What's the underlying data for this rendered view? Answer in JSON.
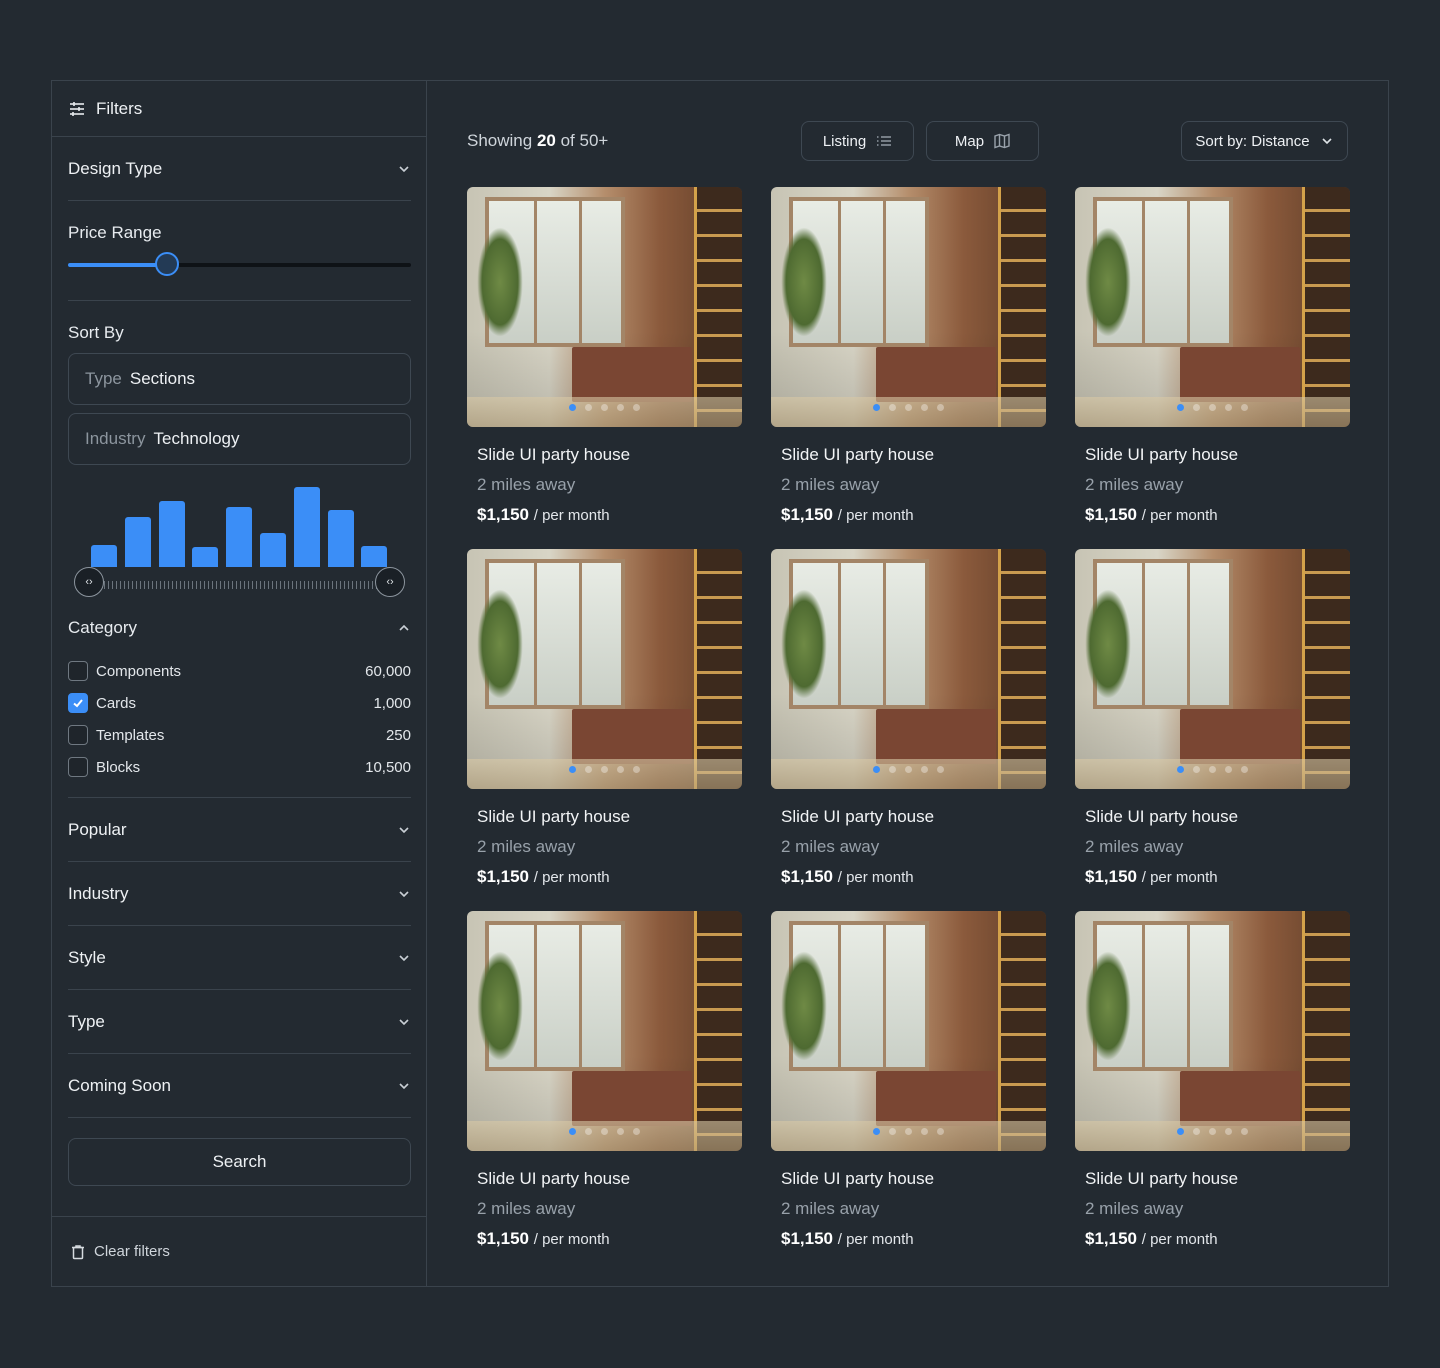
{
  "sidebar": {
    "title": "Filters",
    "design_type": "Design Type",
    "price_range": {
      "label": "Price Range",
      "value_fraction": 0.29
    },
    "sort_by": {
      "label": "Sort By",
      "fields": [
        {
          "key": "Type",
          "value": "Sections"
        },
        {
          "key": "Industry",
          "value": "Technology"
        }
      ]
    },
    "histogram": [
      0.28,
      0.62,
      0.82,
      0.25,
      0.75,
      0.43,
      1.0,
      0.71,
      0.26
    ],
    "category": {
      "label": "Category",
      "items": [
        {
          "label": "Components",
          "count": "60,000",
          "checked": false
        },
        {
          "label": "Cards",
          "count": "1,000",
          "checked": true
        },
        {
          "label": "Templates",
          "count": "250",
          "checked": false
        },
        {
          "label": "Blocks",
          "count": "10,500",
          "checked": false
        }
      ]
    },
    "sections": [
      "Popular",
      "Industry",
      "Style",
      "Type",
      "Coming Soon"
    ],
    "search_label": "Search",
    "clear_label": "Clear filters"
  },
  "toolbar": {
    "showing_prefix": "Showing ",
    "showing_count": "20",
    "showing_suffix": " of 50+",
    "listing_label": "Listing",
    "map_label": "Map",
    "sort_label": "Sort by: Distance"
  },
  "cards": [
    {
      "title": "Slide UI party house",
      "distance": "2 miles away",
      "price": "$1,150",
      "unit": "/ per month"
    },
    {
      "title": "Slide UI party house",
      "distance": "2 miles away",
      "price": "$1,150",
      "unit": "/ per month"
    },
    {
      "title": "Slide UI party house",
      "distance": "2 miles away",
      "price": "$1,150",
      "unit": "/ per month"
    },
    {
      "title": "Slide UI party house",
      "distance": "2 miles away",
      "price": "$1,150",
      "unit": "/ per month"
    },
    {
      "title": "Slide UI party house",
      "distance": "2 miles away",
      "price": "$1,150",
      "unit": "/ per month"
    },
    {
      "title": "Slide UI party house",
      "distance": "2 miles away",
      "price": "$1,150",
      "unit": "/ per month"
    },
    {
      "title": "Slide UI party house",
      "distance": "2 miles away",
      "price": "$1,150",
      "unit": "/ per month"
    },
    {
      "title": "Slide UI party house",
      "distance": "2 miles away",
      "price": "$1,150",
      "unit": "/ per month"
    },
    {
      "title": "Slide UI party house",
      "distance": "2 miles away",
      "price": "$1,150",
      "unit": "/ per month"
    }
  ],
  "colors": {
    "accent": "#3b8ef7",
    "background": "#232a31",
    "border": "#3a434c"
  }
}
